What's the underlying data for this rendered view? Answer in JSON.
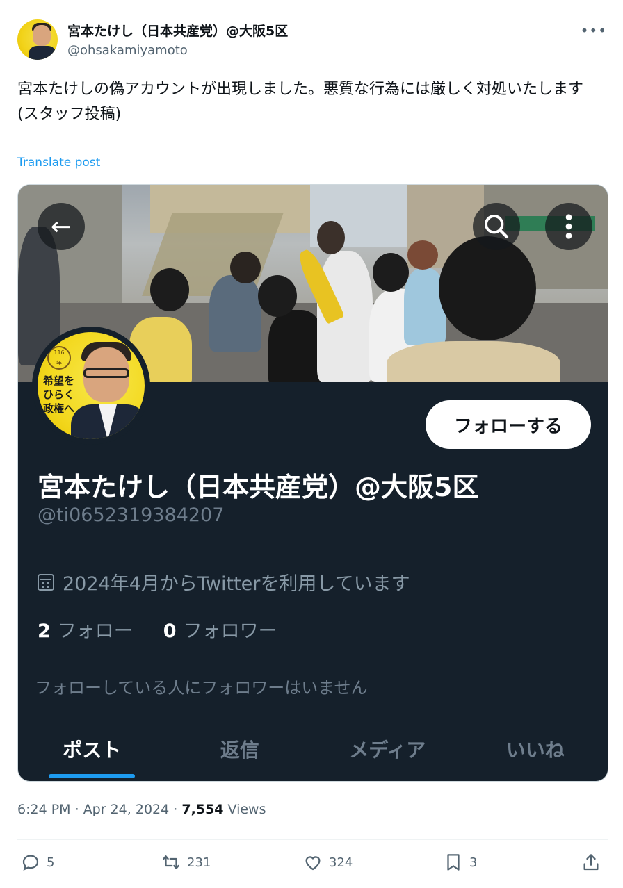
{
  "post": {
    "author_name": "宮本たけし（日本共産党）@大阪5区",
    "author_handle": "@ohsakamiyamoto",
    "avatar_text": "希望を ひらく 政権へ",
    "text": "宮本たけしの偽アカウントが出現しました。悪質な行為には厳しく対処いたします\n(スタッフ投稿)",
    "translate_label": "Translate post",
    "time": "6:24 PM",
    "date": "Apr 24, 2024",
    "views_count": "7,554",
    "views_label": "Views"
  },
  "embedded_profile": {
    "follow_label": "フォローする",
    "name": "宮本たけし（日本共産党）@大阪5区",
    "handle": "@ti0652319384207",
    "joined": "2024年4月からTwitterを利用しています",
    "following_count": "2",
    "following_label": "フォロー",
    "followers_count": "0",
    "followers_label": "フォロワー",
    "no_followers_note": "フォローしている人にフォロワーはいません",
    "avatar_slogan": "希望を ひらく 政権へ",
    "tabs": [
      "ポスト",
      "返信",
      "メディア",
      "いいね"
    ]
  },
  "actions": {
    "replies": "5",
    "reposts": "231",
    "likes": "324",
    "bookmarks": "3"
  },
  "icons": [
    "more-icon",
    "back-arrow-icon",
    "search-icon",
    "kebab-icon",
    "calendar-icon",
    "reply-icon",
    "repost-icon",
    "like-icon",
    "bookmark-icon",
    "share-icon"
  ],
  "colors": {
    "link": "#1d9bf0",
    "profile_bg": "#15202b",
    "muted": "#536471"
  }
}
